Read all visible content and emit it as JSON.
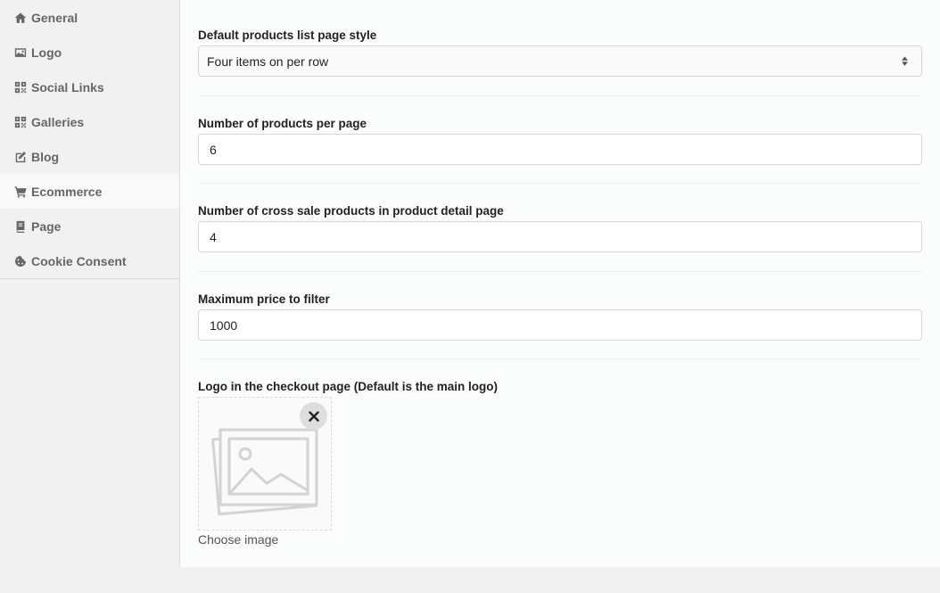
{
  "sidebar": {
    "items": [
      {
        "label": "General",
        "icon": "home-icon",
        "active": false
      },
      {
        "label": "Logo",
        "icon": "image-icon",
        "active": false
      },
      {
        "label": "Social Links",
        "icon": "qrcode-icon",
        "active": false
      },
      {
        "label": "Galleries",
        "icon": "qrcode-icon",
        "active": false
      },
      {
        "label": "Blog",
        "icon": "edit-icon",
        "active": false
      },
      {
        "label": "Ecommerce",
        "icon": "cart-icon",
        "active": true
      },
      {
        "label": "Page",
        "icon": "book-icon",
        "active": false
      },
      {
        "label": "Cookie Consent",
        "icon": "cookie-icon",
        "active": false
      }
    ]
  },
  "form": {
    "list_style": {
      "label": "Default products list page style",
      "value": "Four items on per row"
    },
    "per_page": {
      "label": "Number of products per page",
      "value": "6"
    },
    "cross_sale": {
      "label": "Number of cross sale products in product detail page",
      "value": "4"
    },
    "max_price": {
      "label": "Maximum price to filter",
      "value": "1000"
    },
    "checkout_logo": {
      "label": "Logo in the checkout page (Default is the main logo)",
      "choose_label": "Choose image"
    }
  },
  "colors": {
    "sidebar_bg": "#f1f1f1",
    "main_bg": "#fbfcfc",
    "icon_gray": "#666666"
  }
}
